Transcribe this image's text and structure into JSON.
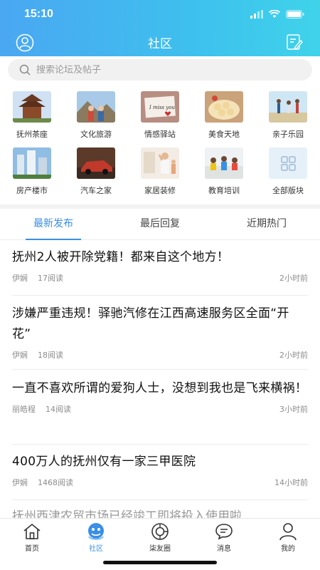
{
  "status_bar": {
    "time": "15:10"
  },
  "nav": {
    "title": "社区",
    "left_icon": "profile-icon",
    "right_icon": "compose-icon"
  },
  "search": {
    "placeholder": "搜索论坛及帖子"
  },
  "categories": [
    {
      "label": "抚州茶座",
      "icon": "pavilion-photo"
    },
    {
      "label": "文化旅游",
      "icon": "travel-photo"
    },
    {
      "label": "情感驿站",
      "icon": "miss-you-photo"
    },
    {
      "label": "美食天地",
      "icon": "food-photo"
    },
    {
      "label": "亲子乐园",
      "icon": "family-photo"
    },
    {
      "label": "房产楼市",
      "icon": "buildings-photo"
    },
    {
      "label": "汽车之家",
      "icon": "car-photo"
    },
    {
      "label": "家居装修",
      "icon": "decoration-photo"
    },
    {
      "label": "教育培训",
      "icon": "classroom-photo"
    },
    {
      "label": "全部版块",
      "icon": "grid-icon"
    }
  ],
  "tabs": [
    "最新发布",
    "最后回复",
    "近期热门"
  ],
  "active_tab": 0,
  "accent_color": "#3a8fe6",
  "posts": [
    {
      "title": "抚州2人被开除党籍！都来自这个地方！",
      "author": "伊娴",
      "reads": "17阅读",
      "time": "2小时前"
    },
    {
      "title": "涉嫌严重违规！驿驰汽修在江西高速服务区全面“开花”",
      "author": "伊娴",
      "reads": "18阅读",
      "time": "2小时前"
    },
    {
      "title": "一直不喜欢所谓的爱狗人士，没想到我也是飞来横祸！",
      "author": "丽皓程",
      "reads": "14阅读",
      "time": "3小时前"
    },
    {
      "title": "400万人的抚州仅有一家三甲医院",
      "author": "伊娴",
      "reads": "1468阅读",
      "time": "14小时前"
    }
  ],
  "partial_post": "抚州西津农贸市场已经竣工即将投入使用啦",
  "tabbar": [
    {
      "label": "首页",
      "icon": "home-icon"
    },
    {
      "label": "社区",
      "icon": "community-icon"
    },
    {
      "label": "柒友圈",
      "icon": "moments-icon"
    },
    {
      "label": "消息",
      "icon": "message-icon"
    },
    {
      "label": "我的",
      "icon": "user-icon"
    }
  ]
}
